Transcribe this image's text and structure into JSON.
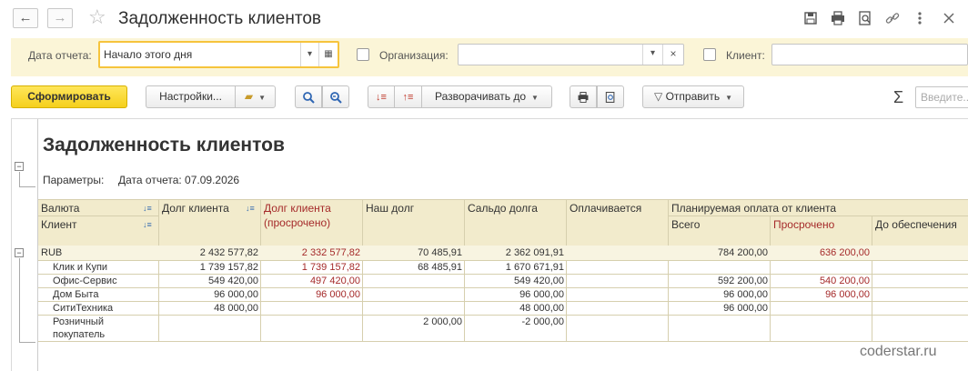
{
  "window": {
    "title": "Задолженность клиентов",
    "back_icon": "arrow-left-icon",
    "forward_icon": "arrow-right-icon",
    "favorite_icon": "star-icon"
  },
  "filters": {
    "report_date_label": "Дата отчета:",
    "report_date_value": "Начало этого дня",
    "organization_label": "Организация:",
    "organization_value": "",
    "client_label": "Клиент:",
    "client_value": ""
  },
  "toolbar": {
    "generate_label": "Сформировать",
    "settings_label": "Настройки...",
    "expand_label": "Разворачивать до",
    "send_label": "Отправить",
    "sigma": "Σ",
    "search_placeholder": "Введите..."
  },
  "report": {
    "title": "Задолженность клиентов",
    "params_label": "Параметры:",
    "params_value": "Дата отчета: 07.09.2026",
    "headers": {
      "currency": "Валюта",
      "client": "Клиент",
      "client_debt": "Долг клиента",
      "client_debt_overdue_1": "Долг клиента",
      "client_debt_overdue_2": "(просрочено)",
      "our_debt": "Наш долг",
      "balance": "Сальдо долга",
      "being_paid": "Оплачивается",
      "planned_payment": "Планируемая оплата от клиента",
      "total": "Всего",
      "overdue": "Просрочено",
      "until_security": "До обеспечения"
    },
    "rows": [
      {
        "name": "RUB",
        "debt": "2 432 577,82",
        "overdue": "2 332 577,82",
        "our_debt": "70 485,91",
        "balance": "2 362 091,91",
        "paying": "",
        "plan_total": "784 200,00",
        "plan_overdue": "636 200,00",
        "plan_security": ""
      },
      {
        "name": "Клик и Купи",
        "debt": "1 739 157,82",
        "overdue": "1 739 157,82",
        "our_debt": "68 485,91",
        "balance": "1 670 671,91",
        "paying": "",
        "plan_total": "",
        "plan_overdue": "",
        "plan_security": ""
      },
      {
        "name": "Офис-Сервис",
        "debt": "549 420,00",
        "overdue": "497 420,00",
        "our_debt": "",
        "balance": "549 420,00",
        "paying": "",
        "plan_total": "592 200,00",
        "plan_overdue": "540 200,00",
        "plan_security": ""
      },
      {
        "name": "Дом Быта",
        "debt": "96 000,00",
        "overdue": "96 000,00",
        "our_debt": "",
        "balance": "96 000,00",
        "paying": "",
        "plan_total": "96 000,00",
        "plan_overdue": "96 000,00",
        "plan_security": ""
      },
      {
        "name": "СитиТехника",
        "debt": "48 000,00",
        "overdue": "",
        "our_debt": "",
        "balance": "48 000,00",
        "paying": "",
        "plan_total": "96 000,00",
        "plan_overdue": "",
        "plan_security": ""
      },
      {
        "name_1": "Розничный",
        "name_2": "покупатель",
        "debt": "",
        "overdue": "",
        "our_debt": "2 000,00",
        "balance": "-2 000,00",
        "paying": "",
        "plan_total": "",
        "plan_overdue": "",
        "plan_security": ""
      }
    ]
  },
  "watermark": "coderstar.ru"
}
